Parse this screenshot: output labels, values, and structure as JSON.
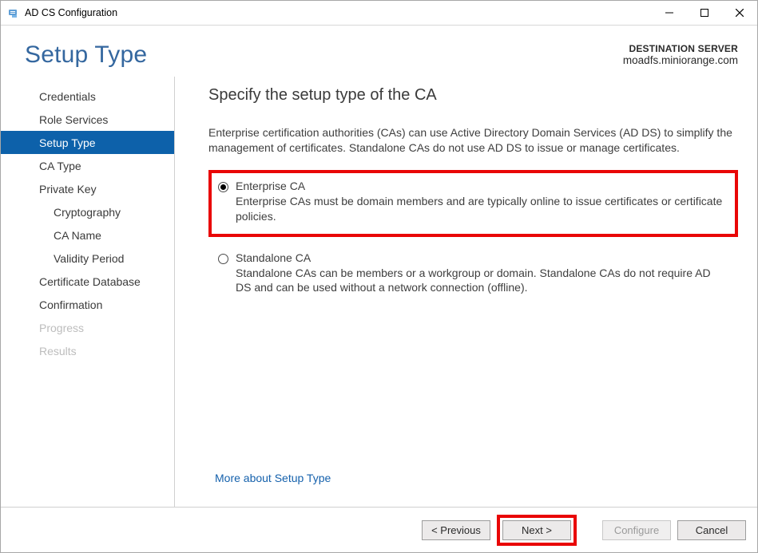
{
  "titlebar": {
    "title": "AD CS Configuration"
  },
  "header": {
    "page_title": "Setup Type",
    "destination_label": "DESTINATION SERVER",
    "destination_server": "moadfs.miniorange.com"
  },
  "sidebar": {
    "items": [
      {
        "label": "Credentials",
        "indent": false,
        "selected": false,
        "disabled": false
      },
      {
        "label": "Role Services",
        "indent": false,
        "selected": false,
        "disabled": false
      },
      {
        "label": "Setup Type",
        "indent": false,
        "selected": true,
        "disabled": false
      },
      {
        "label": "CA Type",
        "indent": false,
        "selected": false,
        "disabled": false
      },
      {
        "label": "Private Key",
        "indent": false,
        "selected": false,
        "disabled": false
      },
      {
        "label": "Cryptography",
        "indent": true,
        "selected": false,
        "disabled": false
      },
      {
        "label": "CA Name",
        "indent": true,
        "selected": false,
        "disabled": false
      },
      {
        "label": "Validity Period",
        "indent": true,
        "selected": false,
        "disabled": false
      },
      {
        "label": "Certificate Database",
        "indent": false,
        "selected": false,
        "disabled": false
      },
      {
        "label": "Confirmation",
        "indent": false,
        "selected": false,
        "disabled": false
      },
      {
        "label": "Progress",
        "indent": false,
        "selected": false,
        "disabled": true
      },
      {
        "label": "Results",
        "indent": false,
        "selected": false,
        "disabled": true
      }
    ]
  },
  "content": {
    "heading": "Specify the setup type of the CA",
    "intro": "Enterprise certification authorities (CAs) can use Active Directory Domain Services (AD DS) to simplify the management of certificates. Standalone CAs do not use AD DS to issue or manage certificates.",
    "options": [
      {
        "title": "Enterprise CA",
        "description": "Enterprise CAs must be domain members and are typically online to issue certificates or certificate policies.",
        "checked": true,
        "highlight": true
      },
      {
        "title": "Standalone CA",
        "description": "Standalone CAs can be members or a workgroup or domain. Standalone CAs do not require AD DS and can be used without a network connection (offline).",
        "checked": false,
        "highlight": false
      }
    ],
    "more_link": "More about Setup Type"
  },
  "footer": {
    "previous": "< Previous",
    "next": "Next >",
    "configure": "Configure",
    "cancel": "Cancel"
  }
}
